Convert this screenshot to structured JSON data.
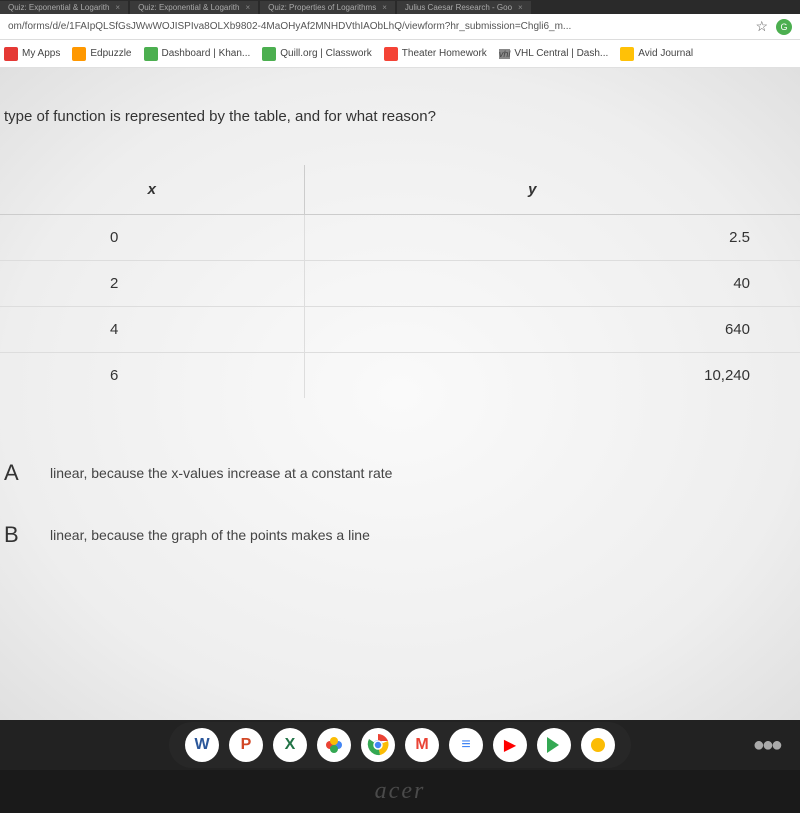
{
  "tabs": [
    {
      "title": "Quiz: Exponential & Logarith"
    },
    {
      "title": "Quiz: Exponential & Logarith"
    },
    {
      "title": "Quiz: Properties of Logarithms"
    },
    {
      "title": "Julius Caesar Research - Goo"
    }
  ],
  "url": "om/forms/d/e/1FAIpQLSfGsJWwWOJISPIva8OLXb9802-4MaOHyAf2MNHDVthIAObLhQ/viewform?hr_submission=Chgli6_m...",
  "bookmarks": [
    {
      "label": "My Apps"
    },
    {
      "label": "Edpuzzle"
    },
    {
      "label": "Dashboard | Khan..."
    },
    {
      "label": "Quill.org | Classwork"
    },
    {
      "label": "Theater Homework"
    },
    {
      "label": "VHL Central | Dash..."
    },
    {
      "label": "Avid Journal"
    }
  ],
  "question": "type of function is represented by the table, and for what reason?",
  "chart_data": {
    "type": "table",
    "headers": {
      "x": "x",
      "y": "y"
    },
    "rows": [
      {
        "x": "0",
        "y": "2.5"
      },
      {
        "x": "2",
        "y": "40"
      },
      {
        "x": "4",
        "y": "640"
      },
      {
        "x": "6",
        "y": "10,240"
      }
    ]
  },
  "answers": [
    {
      "letter": "A",
      "text": "linear, because the x-values increase at a constant rate"
    },
    {
      "letter": "B",
      "text": "linear, because the graph of the points makes a line"
    }
  ],
  "logo": "acer"
}
